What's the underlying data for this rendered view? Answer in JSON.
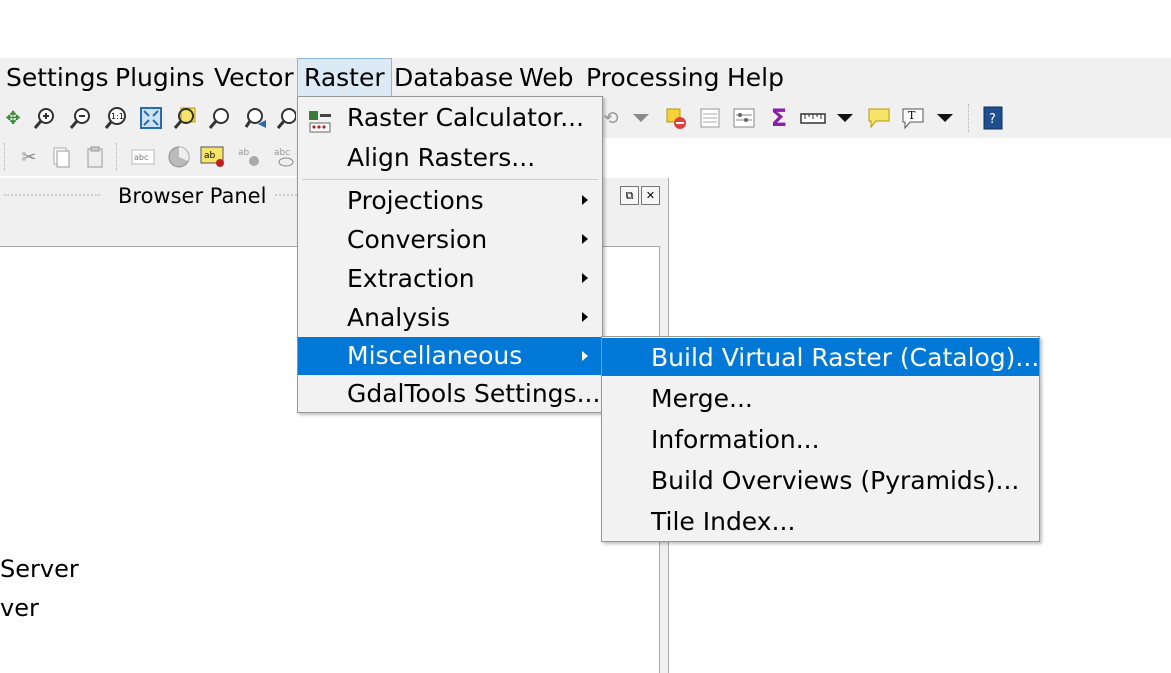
{
  "menubar": {
    "items": [
      "Settings",
      "Plugins",
      "Vector",
      "Raster",
      "Database",
      "Web",
      "Processing",
      "Help"
    ]
  },
  "browser_panel": {
    "title": "Browser Panel",
    "tree_items": [
      "Server",
      "ver"
    ]
  },
  "raster_menu": {
    "items": [
      {
        "label": "Raster Calculator...",
        "icon": "raster-calculator-icon"
      },
      {
        "label": "Align Rasters..."
      },
      {
        "label": "Projections",
        "submenu": true
      },
      {
        "label": "Conversion",
        "submenu": true
      },
      {
        "label": "Extraction",
        "submenu": true
      },
      {
        "label": "Analysis",
        "submenu": true
      },
      {
        "label": "Miscellaneous",
        "submenu": true,
        "highlighted": true
      },
      {
        "label": "GdalTools Settings..."
      }
    ]
  },
  "misc_submenu": {
    "items": [
      {
        "label": "Build Virtual Raster (Catalog)...",
        "highlighted": true
      },
      {
        "label": "Merge..."
      },
      {
        "label": "Information..."
      },
      {
        "label": "Build Overviews (Pyramids)..."
      },
      {
        "label": "Tile Index..."
      }
    ]
  },
  "colors": {
    "highlight": "#0078d7",
    "menu_bg": "#f2f2f2",
    "bar_bg": "#f0f0f0"
  }
}
